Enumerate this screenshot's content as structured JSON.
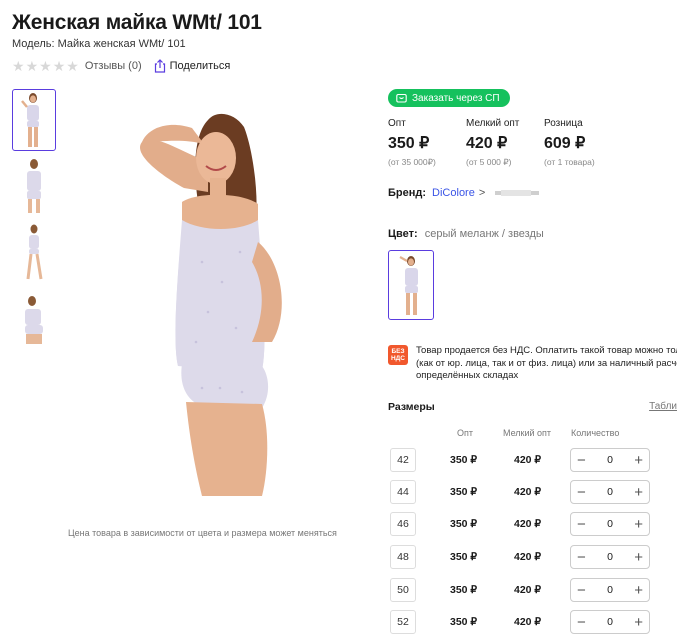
{
  "product": {
    "title": "Женская майка WMt/ 101",
    "model": "Модель: Майка женская WMt/ 101",
    "reviews": "Отзывы (0)",
    "share": "Поделиться",
    "price_note": "Цена товара в зависимости от цвета и размера может меняться"
  },
  "sp_button": {
    "label": "Заказать через СП"
  },
  "prices": [
    {
      "label": "Опт",
      "value": "350 ₽",
      "min": "(от 35 000₽)"
    },
    {
      "label": "Мелкий опт",
      "value": "420 ₽",
      "min": "(от 5 000 ₽)"
    },
    {
      "label": "Розница",
      "value": "609 ₽",
      "min": "(от 1 товара)"
    }
  ],
  "brand": {
    "label": "Бренд:",
    "name": "DiColore",
    "chevron": ">"
  },
  "color": {
    "label": "Цвет:",
    "value": "серый меланж / звезды"
  },
  "vat": {
    "badge_line1": "БЕЗ",
    "badge_line2": "НДС",
    "line1": "Товар продается без НДС. Оплатить такой товар можно тол",
    "line2": "(как от юр. лица, так и от физ. лица) или за наличный расчё",
    "line3": "определённых складах"
  },
  "sizes": {
    "title": "Размеры",
    "table_link": "Табли",
    "col_opt": "Опт",
    "col_small": "Мелкий опт",
    "col_qty": "Количество",
    "rows": [
      {
        "size": "42",
        "opt": "350 ₽",
        "small": "420 ₽",
        "qty": "0"
      },
      {
        "size": "44",
        "opt": "350 ₽",
        "small": "420 ₽",
        "qty": "0"
      },
      {
        "size": "46",
        "opt": "350 ₽",
        "small": "420 ₽",
        "qty": "0"
      },
      {
        "size": "48",
        "opt": "350 ₽",
        "small": "420 ₽",
        "qty": "0"
      },
      {
        "size": "50",
        "opt": "350 ₽",
        "small": "420 ₽",
        "qty": "0"
      },
      {
        "size": "52",
        "opt": "350 ₽",
        "small": "420 ₽",
        "qty": "0"
      }
    ],
    "minus": "−",
    "plus": "+"
  },
  "rating": {
    "stars_filled": 0,
    "stars_total": 5
  },
  "colors": {
    "accent": "#5a3ddf",
    "green": "#15c15d",
    "link": "#3a54e6",
    "vat_badge": "#f1582d"
  },
  "icons": {
    "star": "star-icon",
    "share": "share-icon",
    "cart": "cart-icon",
    "chevron": "chevron-right-icon"
  }
}
